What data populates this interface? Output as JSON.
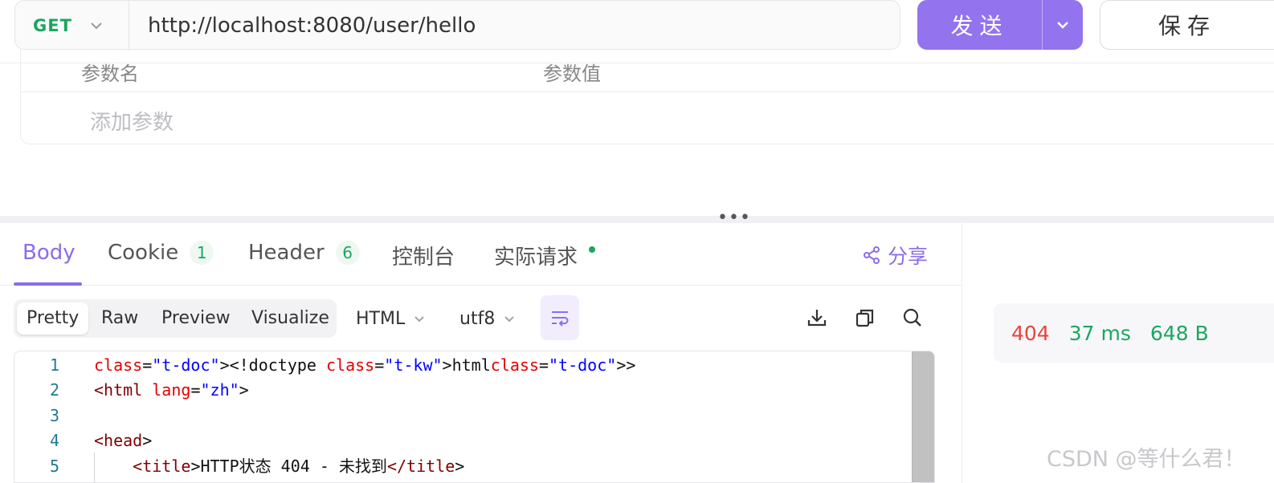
{
  "request": {
    "method": "GET",
    "url": "http://localhost:8080/user/hello",
    "send_label": "发送",
    "save_label": "保存"
  },
  "params": {
    "col_name": "参数名",
    "col_value": "参数值",
    "add_placeholder": "添加参数"
  },
  "response": {
    "tabs": [
      {
        "label": "Body",
        "active": true
      },
      {
        "label": "Cookie",
        "badge": "1"
      },
      {
        "label": "Header",
        "badge": "6"
      },
      {
        "label": "控制台"
      },
      {
        "label": "实际请求",
        "indicator": "green-dot"
      }
    ],
    "share_label": "分享",
    "view_modes": [
      "Pretty",
      "Raw",
      "Preview",
      "Visualize"
    ],
    "active_view": "Pretty",
    "format": "HTML",
    "encoding": "utf8",
    "status": {
      "code": "404",
      "time": "37 ms",
      "size": "648 B"
    }
  },
  "code_lines": [
    {
      "n": "1",
      "text": "<!doctype html>"
    },
    {
      "n": "2",
      "text": "<html lang=\"zh\">"
    },
    {
      "n": "3",
      "text": ""
    },
    {
      "n": "4",
      "text": "<head>"
    },
    {
      "n": "5",
      "text": "    <title>HTTP状态 404 - 未找到</title>"
    }
  ],
  "watermark": "CSDN @等什么君！",
  "colors": {
    "accent": "#9373ee",
    "success": "#1aa760",
    "error": "#e5453c"
  },
  "icons": [
    "chevron-down-icon",
    "share-icon",
    "wrap-lines-icon",
    "download-icon",
    "copy-icon",
    "search-icon"
  ]
}
